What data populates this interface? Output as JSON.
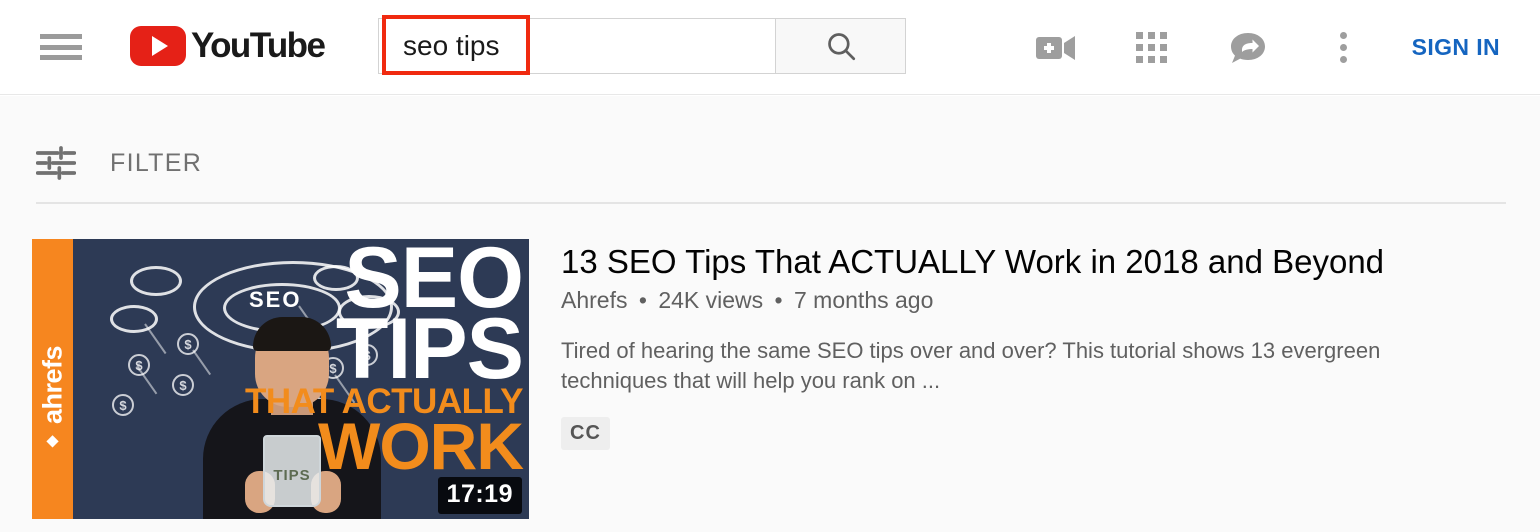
{
  "header": {
    "menu_icon": "hamburger-menu-icon",
    "logo_text": "YouTube",
    "logo_icon": "youtube-play-icon",
    "search": {
      "value": "seo tips",
      "placeholder": "Search",
      "button_icon": "search-icon",
      "highlight_color": "#f02a10"
    },
    "icons": [
      {
        "name": "create-video-icon",
        "label": "Create"
      },
      {
        "name": "apps-grid-icon",
        "label": "YouTube apps"
      },
      {
        "name": "message-reply-icon",
        "label": "Messages"
      },
      {
        "name": "more-vertical-icon",
        "label": "Settings"
      }
    ],
    "sign_in_label": "SIGN IN",
    "sign_in_color": "#1565c0"
  },
  "filter": {
    "icon": "tune-sliders-icon",
    "label": "FILTER"
  },
  "results": [
    {
      "title": "13 SEO Tips That ACTUALLY Work in 2018 and Beyond",
      "channel": "Ahrefs",
      "views": "24K views",
      "age": "7 months ago",
      "separator": "•",
      "description": "Tired of hearing the same SEO tips over and over? This tutorial shows 13 evergreen techniques that will help you rank on ...",
      "badges": [
        "CC"
      ],
      "duration": "17:19",
      "thumbnail": {
        "brand": "ahrefs",
        "brand_bar_color": "#f6861f",
        "background_color": "#2d3a55",
        "headline_line1": "SEO",
        "headline_line2": "TIPS",
        "headline_line3": "THAT ACTUALLY",
        "headline_line4": "WORK",
        "headline_accent_color": "#f28c1c",
        "cloud_label": "SEO",
        "jar_label": "TIPS",
        "coin_symbol": "$"
      }
    }
  ]
}
